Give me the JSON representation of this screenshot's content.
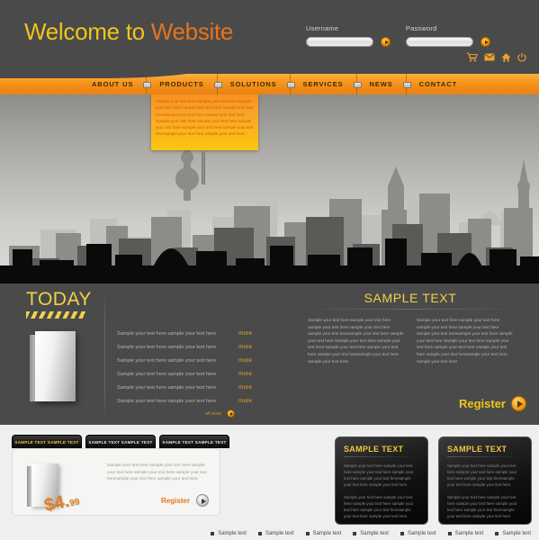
{
  "header": {
    "logo_part1": "Welcome to",
    "logo_part2": "Website",
    "username_label": "Username",
    "password_label": "Password",
    "username_value": "",
    "password_value": "",
    "icons": [
      "cart-icon",
      "mail-icon",
      "home-icon",
      "power-icon"
    ],
    "colors": {
      "bar": "#4a4a4a",
      "gold": "#f0c419",
      "orange": "#e8731c"
    }
  },
  "nav": {
    "items": [
      {
        "label": "ABOUT US"
      },
      {
        "label": "PRODUCTS"
      },
      {
        "label": "SOLUTIONS"
      },
      {
        "label": "SERVICES"
      },
      {
        "label": "NEWS"
      },
      {
        "label": "CONTACT"
      }
    ],
    "accent": "#f7941e"
  },
  "banner": {
    "callout_text": "Sample your text here sample your text here sample your text here sample your text here sample your text heresample your text here sample your text here Sample your text here sample your text here sample your text here sample your text here sample your text heresample your text here sample your text here"
  },
  "today": {
    "heading": "TODAY",
    "news": [
      {
        "text": "Sample your text here sample your text here",
        "more": "more"
      },
      {
        "text": "Sample your text here sample your text here",
        "more": "more"
      },
      {
        "text": "Sample your text here sample your text here",
        "more": "more"
      },
      {
        "text": "Sample your text here sample your text here",
        "more": "more"
      },
      {
        "text": "Sample your text here sample your text here",
        "more": "more"
      },
      {
        "text": "Sample your text here sample your text here",
        "more": "more"
      }
    ],
    "all_news_label": "all news"
  },
  "feature": {
    "heading": "SAMPLE TEXT",
    "column_left": "Sample your text here sample your text here sample your text here sample your text here sample your text heresample your text here sample your text here Sample your text here sample your text here sample your text here sample your text here sample your text heresample your text here sample your text here",
    "column_right": "Sample your text here sample your text here sample your text here sample your text here sample your text heresample your text here sample your text here Sample your text here sample your text here sample your text here sample your text here sample your text heresample your text here sample your text here",
    "register_label": "Register"
  },
  "product_panel": {
    "tabs": [
      {
        "label": "SAMPLE TEXT SAMPLE TEXT",
        "active": true
      },
      {
        "label": "SAMPLE TEXT SAMPLE TEXT",
        "active": false
      },
      {
        "label": "SAMPLE TEXT SAMPLE TEXT",
        "active": false
      }
    ],
    "price_major": "$4.",
    "price_minor": "99",
    "description": "Sample your text here sample your text here sample your text here sample your text here sample your text heresample your text here sample your text here",
    "register_label": "Register"
  },
  "cards": [
    {
      "heading": "SAMPLE TEXT",
      "para1": "Sample your text here sample your text here sample your text here sample your text here sample your text heresample your text here sample your text here",
      "para2": "Sample your text here sample your text here sample your text here sample your text here sample your text heresample your text here sample your text here"
    },
    {
      "heading": "SAMPLE TEXT",
      "para1": "Sample your text here sample your text here sample your text here sample your text here sample your text heresample your text here sample your text here",
      "para2": "Sample your text here sample your text here sample your text here sample your text here sample your text heresample your text here sample your text here"
    }
  ],
  "footer": {
    "links": [
      {
        "label": "Sample text"
      },
      {
        "label": "Sample text"
      },
      {
        "label": "Sample text"
      },
      {
        "label": "Sample text"
      },
      {
        "label": "Sample text"
      },
      {
        "label": "Sample text"
      },
      {
        "label": "Sample text"
      }
    ]
  }
}
